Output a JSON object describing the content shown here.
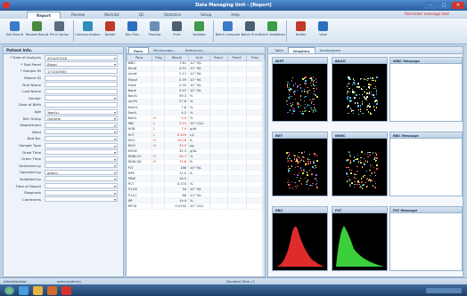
{
  "window": {
    "title": "Data Managing Unit - [Report]"
  },
  "app_tabs": [
    {
      "label": "Report",
      "active": true
    },
    {
      "label": "Review",
      "active": false
    },
    {
      "label": "Worklist",
      "active": false
    },
    {
      "label": "QC",
      "active": false
    },
    {
      "label": "Statistics",
      "active": false
    },
    {
      "label": "Setup",
      "active": false
    },
    {
      "label": "Help",
      "active": false
    }
  ],
  "alert_text": "Reminder message text",
  "ribbon": {
    "buttons": [
      {
        "label": "Edit Result",
        "icon": "edit-result-icon",
        "color": "#3a7bc8"
      },
      {
        "label": "Review Result",
        "icon": "review-icon",
        "color": "#4a8a3e"
      },
      {
        "label": "Print Option",
        "icon": "print-option-icon",
        "color": "#5b6b7e"
      },
      {
        "label": "Communication",
        "icon": "communication-icon",
        "color": "#2f8fb8"
      },
      {
        "label": "Delete",
        "icon": "delete-icon",
        "color": "#c0392b"
      },
      {
        "label": "Rev Prev",
        "icon": "prev-icon",
        "color": "#2e6fbd"
      },
      {
        "label": "Preview",
        "icon": "preview-icon",
        "color": "#6a8fb5"
      },
      {
        "label": "Print",
        "icon": "print-icon",
        "color": "#4d5f73"
      },
      {
        "label": "Validate",
        "icon": "validate-icon",
        "color": "#3f9b4a"
      },
      {
        "label": "Batch Compare",
        "icon": "compare-icon",
        "color": "#3a7bc8"
      },
      {
        "label": "Batch Print",
        "icon": "batch-print-icon",
        "color": "#4d5f73"
      },
      {
        "label": "Batch Validation",
        "icon": "batch-validate-icon",
        "color": "#3f9b4a"
      },
      {
        "label": "Delete",
        "icon": "delete-batch-icon",
        "color": "#c0392b"
      },
      {
        "label": "View",
        "icon": "view-icon",
        "color": "#2e6fbd"
      }
    ]
  },
  "patient": {
    "header": "Patient Info.",
    "fields": [
      {
        "label": "* Date of Analysis",
        "value": "2014/03/18",
        "dropdown": true
      },
      {
        "label": "* Test Panel",
        "value": "Blood",
        "dropdown": true
      },
      {
        "label": "* Sample ID",
        "value": "171203500",
        "dropdown": false
      },
      {
        "label": "Patient ID",
        "value": "",
        "dropdown": false
      },
      {
        "label": "First Name",
        "value": "",
        "dropdown": false
      },
      {
        "label": "Last Name",
        "value": "",
        "dropdown": false
      },
      {
        "label": "Gender",
        "value": "",
        "dropdown": true
      },
      {
        "label": "Date of Birth",
        "value": "",
        "dropdown": false
      },
      {
        "label": "Age",
        "value": "Year(s)",
        "dropdown": true
      },
      {
        "label": "Ref. Group",
        "value": "General",
        "dropdown": true
      },
      {
        "label": "Department",
        "value": "",
        "dropdown": true
      },
      {
        "label": "Ward",
        "value": "",
        "dropdown": true
      },
      {
        "label": "Bed No.",
        "value": "",
        "dropdown": true
      },
      {
        "label": "Sample Type",
        "value": "",
        "dropdown": true
      },
      {
        "label": "Draw Time",
        "value": "",
        "dropdown": true
      },
      {
        "label": "Order Time",
        "value": "",
        "dropdown": true
      },
      {
        "label": "Delivered by",
        "value": "",
        "dropdown": true
      },
      {
        "label": "Operated by",
        "value": "admin",
        "dropdown": true
      },
      {
        "label": "Validated by",
        "value": "",
        "dropdown": true
      },
      {
        "label": "Time of Report",
        "value": "",
        "dropdown": true
      },
      {
        "label": "Diagnosis",
        "value": "",
        "dropdown": true
      },
      {
        "label": "Comments",
        "value": "",
        "dropdown": true
      }
    ]
  },
  "results": {
    "tabs": [
      "Para.",
      "Microscopic...",
      "Reference..."
    ],
    "columns": [
      "Para.",
      "Flag",
      "Result",
      "Unit",
      "Prev1",
      "Prev2",
      "Prev"
    ],
    "rows": [
      [
        "WBC",
        "",
        "7.61",
        "10^9/L"
      ],
      [
        "Neu#",
        "",
        "4.51",
        "10^9/L"
      ],
      [
        "Lym#",
        "",
        "2.11",
        "10^9/L"
      ],
      [
        "Mon#",
        "",
        "0.59",
        "10^9/L"
      ],
      [
        "Eos#",
        "",
        "0.32",
        "10^9/L"
      ],
      [
        "Bas#",
        "",
        "0.07",
        "10^9/L"
      ],
      [
        "Neu%",
        "",
        "59.3",
        "%"
      ],
      [
        "Lym%",
        "",
        "27.8",
        "%"
      ],
      [
        "Mon%",
        "",
        "7.8",
        "%"
      ],
      [
        "Eos%",
        "",
        "4.2",
        "%"
      ],
      [
        "Bas%",
        "H",
        "0.9",
        "%"
      ],
      [
        "RBC",
        "L",
        "2.21",
        "10^12/L"
      ],
      [
        "HGB",
        "L",
        "7.4",
        "g/dL"
      ],
      [
        "HCT",
        "L",
        "0.229",
        "L/L"
      ],
      [
        "MCV",
        "H",
        "103.6",
        "fL"
      ],
      [
        "MCH",
        "H",
        "33.5",
        "pg"
      ],
      [
        "MCHC",
        "",
        "32.3",
        "g/dL"
      ],
      [
        "RDW-CV",
        "H",
        "20.7",
        "%"
      ],
      [
        "RDW-SD",
        "H",
        "74.8",
        "fL"
      ],
      [
        "PLT",
        "",
        "186",
        "10^9/L"
      ],
      [
        "MPV",
        "",
        "11.0",
        "fL"
      ],
      [
        "PDW",
        "",
        "16.5",
        ""
      ],
      [
        "PCT",
        "",
        "0.174",
        "%"
      ],
      [
        "P-LCR",
        "",
        "34",
        "10^9/L"
      ],
      [
        "P-LCC",
        "",
        "66",
        "10^9/L"
      ],
      [
        "IRF",
        "",
        "19.4",
        "%"
      ],
      [
        "RET#",
        "",
        "0.0792",
        "10^12/L"
      ]
    ]
  },
  "graphics": {
    "tabs": [
      "Table",
      "Graphics",
      "Scattergram"
    ],
    "plots": [
      {
        "title": "DIFF"
      },
      {
        "title": "BASO"
      },
      {
        "title": "RET"
      },
      {
        "title": "NRBC"
      },
      {
        "title": "RBC"
      },
      {
        "title": "PLT"
      }
    ],
    "messages": [
      {
        "title": "WBC Message",
        "lines": []
      },
      {
        "title": "RBC Message",
        "lines": []
      },
      {
        "title": "PLT Message",
        "lines": []
      }
    ]
  },
  "statusbar": {
    "left": "Administrator",
    "user": "admin(admin)",
    "right": "Doubled Tube / 1"
  }
}
